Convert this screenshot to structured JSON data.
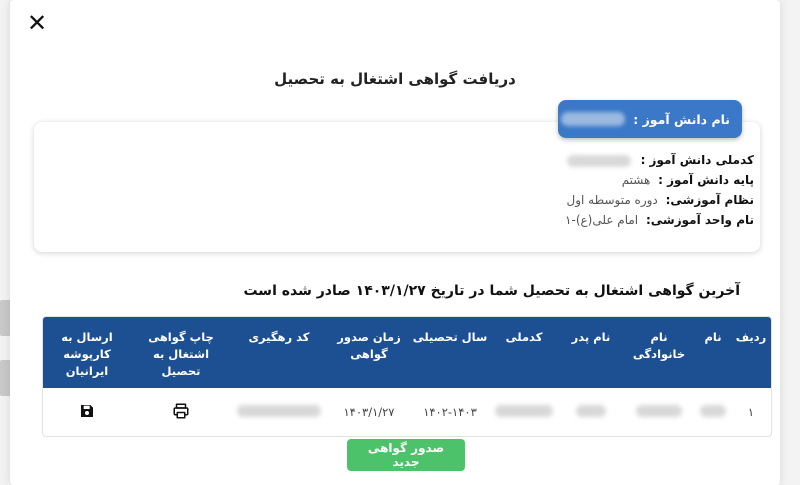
{
  "modal": {
    "close_glyph": "✕",
    "title": "دریافت گواهی اشتغال به تحصیل"
  },
  "student": {
    "name_label": "نام دانش آموز :",
    "name_value": "",
    "national_code_label": "کدملی دانش آموز :",
    "national_code_value": "",
    "grade_label": "پایه دانش آموز :",
    "grade_value": "هشتم",
    "system_label": "نظام آموزشی:",
    "system_value": "دوره متوسطه اول",
    "school_label": "نام واحد آموزشی:",
    "school_value": "امام علی(ع)-۱"
  },
  "issued_note": "آخرین گواهی اشتغال به تحصیل شما در تاریخ ۱۴۰۳/۱/۲۷ صادر شده است",
  "table": {
    "headers": {
      "row": "ردیف",
      "first_name": "نام",
      "last_name": "نام خانوادگی",
      "father": "نام پدر",
      "national_code": "کدملی",
      "school_year": "سال تحصیلی",
      "issue_time": "زمان صدور گواهی",
      "tracking": "کد رهگیری",
      "print": "چاپ گواهی اشتغال به تحصیل",
      "send": "ارسال به کارپوشه ایرانیان"
    },
    "row1": {
      "row": "۱",
      "school_year": "۱۴۰۲-۱۴۰۳",
      "issue_time": "۱۴۰۳/۱/۲۷"
    }
  },
  "icons": {
    "print": "printer-icon",
    "save": "floppy-disk-icon"
  },
  "buttons": {
    "new_certificate": "صدور گواهی جدید"
  },
  "colors": {
    "header_blue": "#1d4f93",
    "badge_blue": "#3b78c8",
    "button_green": "#4cc36a"
  }
}
